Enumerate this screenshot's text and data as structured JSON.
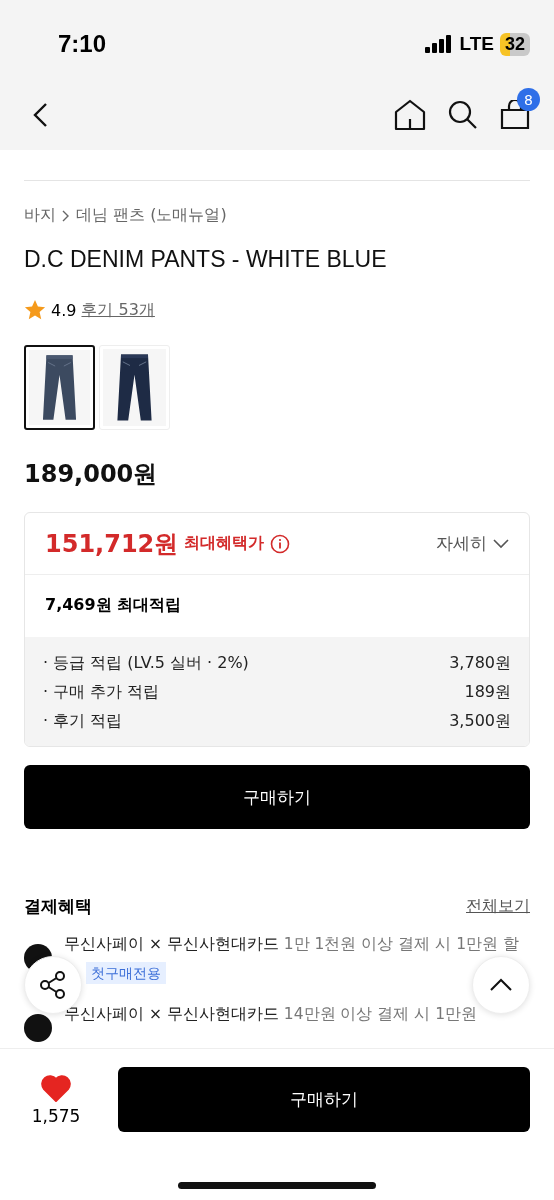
{
  "status_bar": {
    "time": "7:10",
    "network": "LTE",
    "battery": "32"
  },
  "nav": {
    "cart_count": "8"
  },
  "breadcrumb": [
    "바지",
    "데님 팬츠 (노매뉴얼)"
  ],
  "product": {
    "title": "D.C DENIM PANTS - WHITE BLUE",
    "rating": "4.9",
    "reviews": "후기 53개",
    "thumbnails": [
      {
        "kind": "picture",
        "selected": true
      },
      {
        "kind": "picture",
        "selected": false
      }
    ],
    "price": "189,000원"
  },
  "benefit": {
    "price": "151,712원",
    "label": "최대혜택가",
    "detail": "자세히",
    "points_total": "7,469원 최대적립",
    "points": [
      {
        "label": "· 등급 적립 (LV.5 실버 · 2%)",
        "amount": "3,780원"
      },
      {
        "label": "· 구매 추가 적립",
        "amount": "189원"
      },
      {
        "label": "· 후기 적립",
        "amount": "3,500원"
      }
    ]
  },
  "buy_button": "구매하기",
  "payment": {
    "title": "결제혜택",
    "view_all": "전체보기",
    "items": [
      {
        "brand": "무신사페이 × 무신사현대카드",
        "text": "1만 1천원 이상 결제 시 1만원 할",
        "badge": "첫구매전용"
      },
      {
        "brand": "무신사페이 × 무신사현대카드",
        "text": "14만원 이상 결제 시 1만원"
      }
    ]
  },
  "bottom_bar": {
    "liked": true,
    "likes": "1,575",
    "button": "구매하기"
  }
}
